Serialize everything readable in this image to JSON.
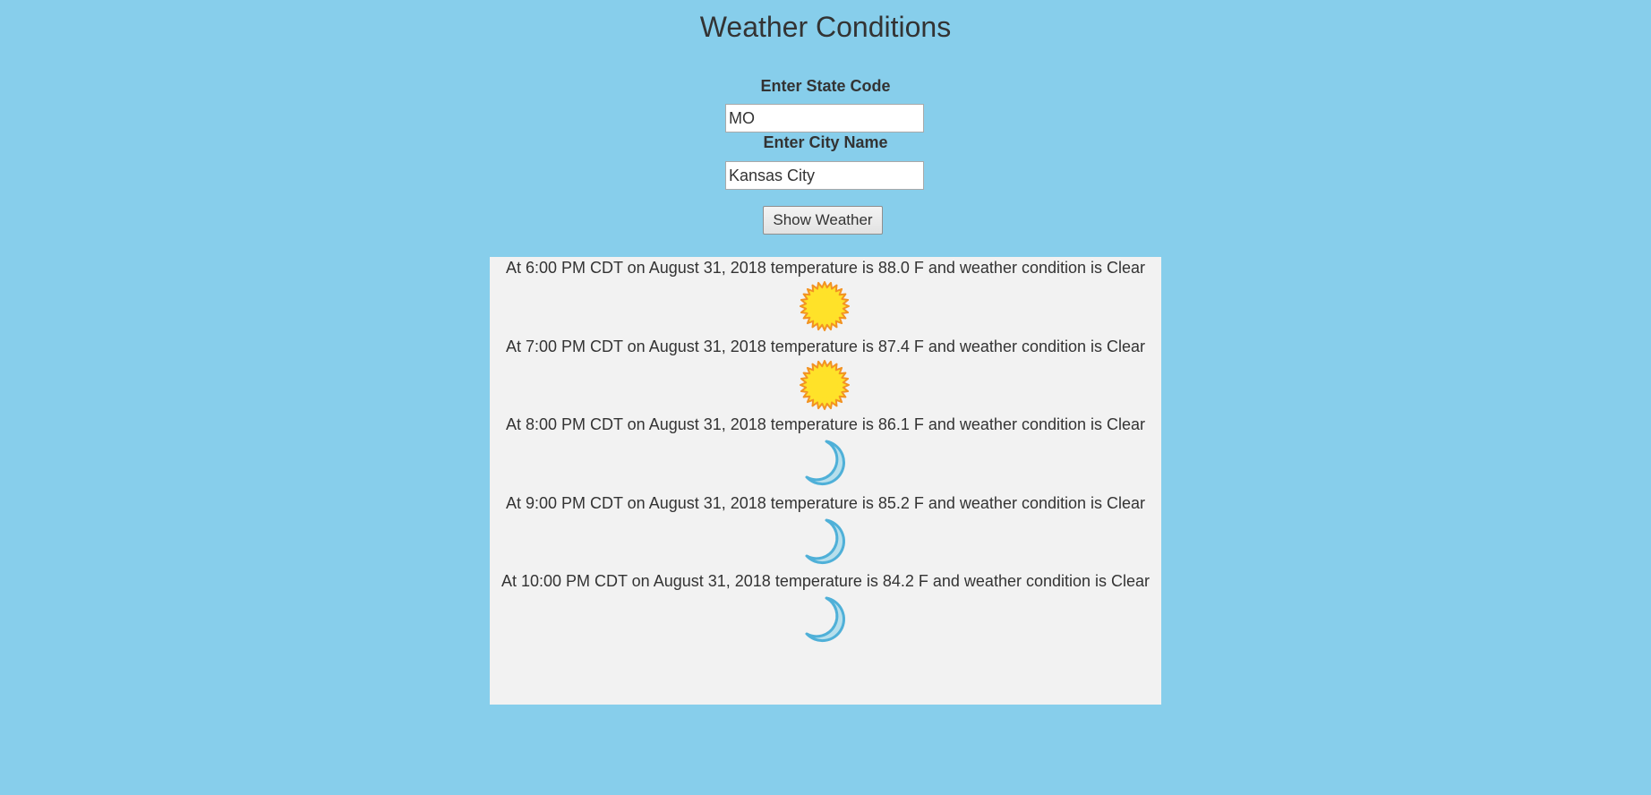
{
  "header": {
    "title": "Weather Conditions"
  },
  "form": {
    "state_label": "Enter State Code",
    "state_value": "MO",
    "city_label": "Enter City Name",
    "city_value": "Kansas City",
    "submit_label": "Show Weather"
  },
  "colors": {
    "background": "#87ceeb",
    "panel": "#f2f2f2",
    "sun_fill": "#ffe229",
    "sun_stroke": "#f29322",
    "moon_fill": "#b7dfec",
    "moon_stroke": "#4fb0d8"
  },
  "forecast": [
    {
      "text": "At 6:00 PM CDT on August 31, 2018 temperature is 88.0 F and weather condition is Clear",
      "icon": "sun-icon"
    },
    {
      "text": "At 7:00 PM CDT on August 31, 2018 temperature is 87.4 F and weather condition is Clear",
      "icon": "sun-icon"
    },
    {
      "text": "At 8:00 PM CDT on August 31, 2018 temperature is 86.1 F and weather condition is Clear",
      "icon": "moon-icon"
    },
    {
      "text": "At 9:00 PM CDT on August 31, 2018 temperature is 85.2 F and weather condition is Clear",
      "icon": "moon-icon"
    },
    {
      "text": "At 10:00 PM CDT on August 31, 2018 temperature is 84.2 F and weather condition is Clear",
      "icon": "moon-icon"
    }
  ]
}
